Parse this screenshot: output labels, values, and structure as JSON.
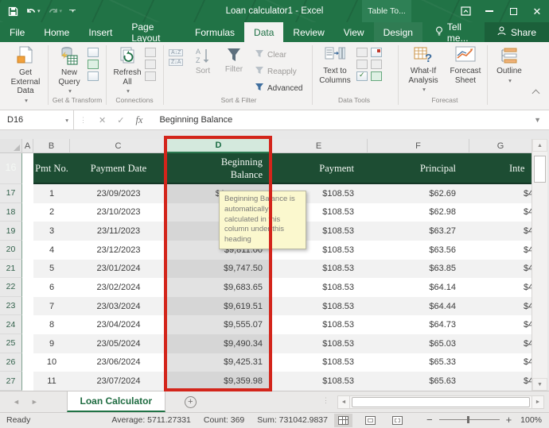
{
  "window": {
    "title": "Loan calculator1 - Excel",
    "contextual_group": "Table To..."
  },
  "tabs": {
    "items": [
      "File",
      "Home",
      "Insert",
      "Page Layout",
      "Formulas",
      "Data",
      "Review",
      "View",
      "Design"
    ],
    "active": "Data",
    "tell_me": "Tell me...",
    "share": "Share"
  },
  "ribbon": {
    "get_external_data": "Get External\nData",
    "new_query": "New\nQuery",
    "refresh_all": "Refresh\nAll",
    "sort": "Sort",
    "filter": "Filter",
    "clear": "Clear",
    "reapply": "Reapply",
    "advanced": "Advanced",
    "text_to_columns": "Text to\nColumns",
    "what_if_analysis": "What-If\nAnalysis",
    "forecast_sheet": "Forecast\nSheet",
    "outline": "Outline",
    "labels": {
      "get_transform": "Get & Transform",
      "connections": "Connections",
      "sort_filter": "Sort & Filter",
      "data_tools": "Data Tools",
      "forecast": "Forecast"
    }
  },
  "formula_bar": {
    "name_box": "D16",
    "content": "Beginning Balance"
  },
  "sheet": {
    "columns": [
      "A",
      "B",
      "C",
      "D",
      "E",
      "F",
      "G"
    ],
    "selected_column": "D",
    "header_row": {
      "num": "16",
      "pmt_no": "Pmt No.",
      "payment_date": "Payment Date",
      "beginning_balance": "Beginning Balance",
      "payment": "Payment",
      "principal": "Principal",
      "interest": "Inte"
    },
    "rows": [
      {
        "num": "17",
        "pmt": "1",
        "date": "23/09/2023",
        "bb": "$1",
        "trunc": true,
        "payment": "$108.53",
        "principal": "$62.69",
        "interest": "$4"
      },
      {
        "num": "18",
        "pmt": "2",
        "date": "23/10/2023",
        "bb": "$",
        "trunc": true,
        "payment": "$108.53",
        "principal": "$62.98",
        "interest": "$4"
      },
      {
        "num": "19",
        "pmt": "3",
        "date": "23/11/2023",
        "bb": "$",
        "trunc": true,
        "payment": "$108.53",
        "principal": "$63.27",
        "interest": "$4"
      },
      {
        "num": "20",
        "pmt": "4",
        "date": "23/12/2023",
        "bb": "$9,811.00",
        "trunc": false,
        "payment": "$108.53",
        "principal": "$63.56",
        "interest": "$4"
      },
      {
        "num": "21",
        "pmt": "5",
        "date": "23/01/2024",
        "bb": "$9,747.50",
        "trunc": false,
        "payment": "$108.53",
        "principal": "$63.85",
        "interest": "$4"
      },
      {
        "num": "22",
        "pmt": "6",
        "date": "23/02/2024",
        "bb": "$9,683.65",
        "trunc": false,
        "payment": "$108.53",
        "principal": "$64.14",
        "interest": "$4"
      },
      {
        "num": "23",
        "pmt": "7",
        "date": "23/03/2024",
        "bb": "$9,619.51",
        "trunc": false,
        "payment": "$108.53",
        "principal": "$64.44",
        "interest": "$4"
      },
      {
        "num": "24",
        "pmt": "8",
        "date": "23/04/2024",
        "bb": "$9,555.07",
        "trunc": false,
        "payment": "$108.53",
        "principal": "$64.73",
        "interest": "$4"
      },
      {
        "num": "25",
        "pmt": "9",
        "date": "23/05/2024",
        "bb": "$9,490.34",
        "trunc": false,
        "payment": "$108.53",
        "principal": "$65.03",
        "interest": "$4"
      },
      {
        "num": "26",
        "pmt": "10",
        "date": "23/06/2024",
        "bb": "$9,425.31",
        "trunc": false,
        "payment": "$108.53",
        "principal": "$65.33",
        "interest": "$4"
      },
      {
        "num": "27",
        "pmt": "11",
        "date": "23/07/2024",
        "bb": "$9,359.98",
        "trunc": false,
        "payment": "$108.53",
        "principal": "$65.63",
        "interest": "$4"
      }
    ],
    "tooltip": "Beginning Balance is automatically calculated in this column under this heading"
  },
  "sheet_tabs": {
    "active": "Loan Calculator"
  },
  "status": {
    "mode": "Ready",
    "average": "Average: 5711.27331",
    "count": "Count: 369",
    "sum": "Sum: 731042.9837",
    "zoom": "100%"
  },
  "colors": {
    "excel_green": "#217346",
    "table_header_green": "#1d4d33",
    "selected_column_fill": "#d4e9dd",
    "annotation_red": "#d3251b",
    "tooltip_bg": "#fbf8ce"
  }
}
